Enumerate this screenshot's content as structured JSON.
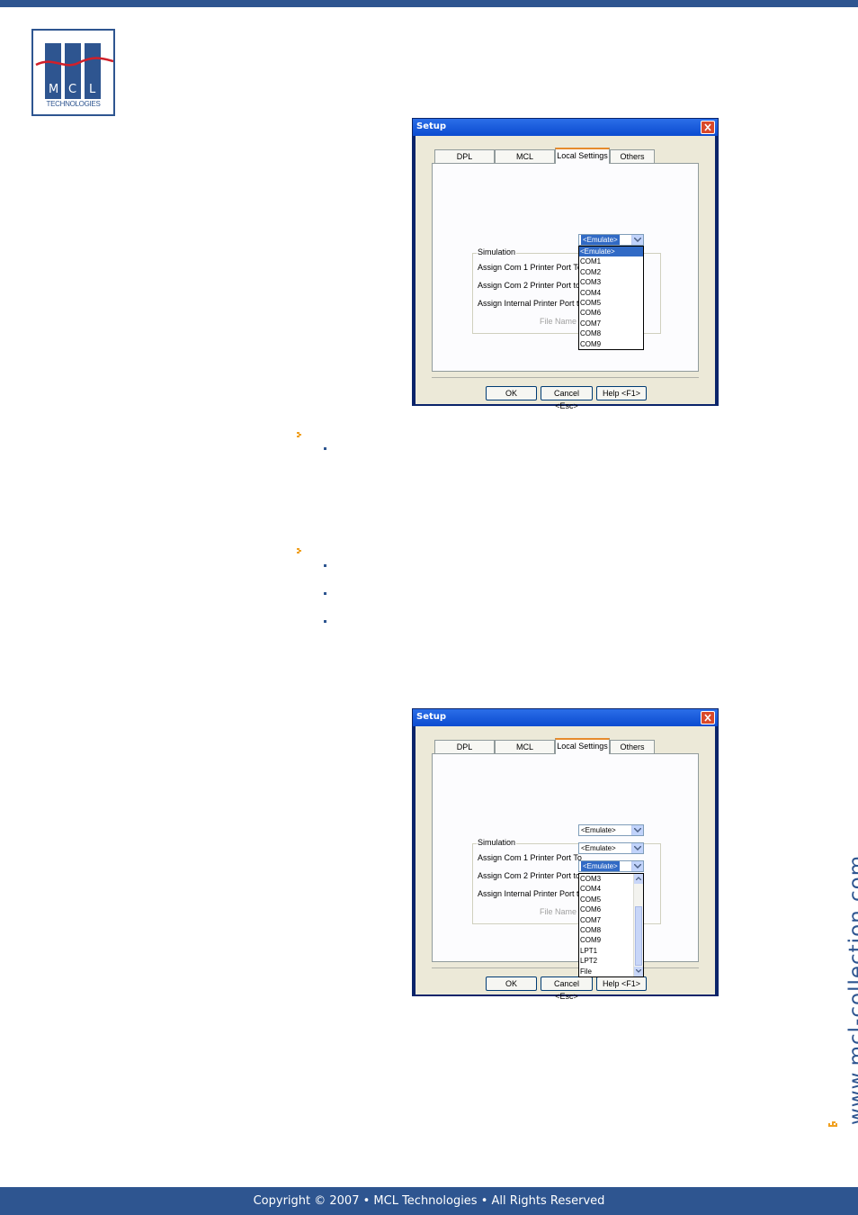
{
  "page": {
    "logo": {
      "letters": [
        "M",
        "C",
        "L"
      ],
      "subtitle": "TECHNOLOGIES"
    },
    "side_url": "www.mcl-collection.com",
    "footer": "Copyright © 2007 • MCL Technologies • All Rights Reserved"
  },
  "colors": {
    "brand": "#2e5590",
    "accent": "#f0a020"
  },
  "dialog1": {
    "title": "Setup",
    "tabs": [
      "DPL Connection",
      "MCL Connection",
      "Local Settings",
      "Others"
    ],
    "active_tab": "Local Settings",
    "group_label": "Simulation",
    "rows": [
      {
        "label": "Assign Com 1 Printer Port To",
        "value": "<Emulate>"
      },
      {
        "label": "Assign Com 2 Printer Port to",
        "value": ""
      },
      {
        "label": "Assign Internal Printer Port to",
        "value": ""
      },
      {
        "label": "File Name",
        "value": ""
      }
    ],
    "dropdown_items": [
      "<Emulate>",
      "COM1",
      "COM2",
      "COM3",
      "COM4",
      "COM5",
      "COM6",
      "COM7",
      "COM8",
      "COM9"
    ],
    "dropdown_selected": "<Emulate>",
    "buttons": {
      "ok": "OK",
      "cancel": "Cancel <Esc>",
      "help": "Help <F1>"
    }
  },
  "dialog2": {
    "title": "Setup",
    "tabs": [
      "DPL Connection",
      "MCL Connection",
      "Local Settings",
      "Others"
    ],
    "active_tab": "Local Settings",
    "group_label": "Simulation",
    "rows": [
      {
        "label": "Assign Com 1 Printer Port To",
        "value": "<Emulate>"
      },
      {
        "label": "Assign Com 2 Printer Port to",
        "value": "<Emulate>"
      },
      {
        "label": "Assign Internal Printer Port to",
        "value": "<Emulate>"
      },
      {
        "label": "File Name",
        "value": ""
      }
    ],
    "dropdown_items": [
      "COM3",
      "COM4",
      "COM5",
      "COM6",
      "COM7",
      "COM8",
      "COM9",
      "LPT1",
      "LPT2",
      "File"
    ],
    "buttons": {
      "ok": "OK",
      "cancel": "Cancel <Esc>",
      "help": "Help <F1>"
    }
  }
}
